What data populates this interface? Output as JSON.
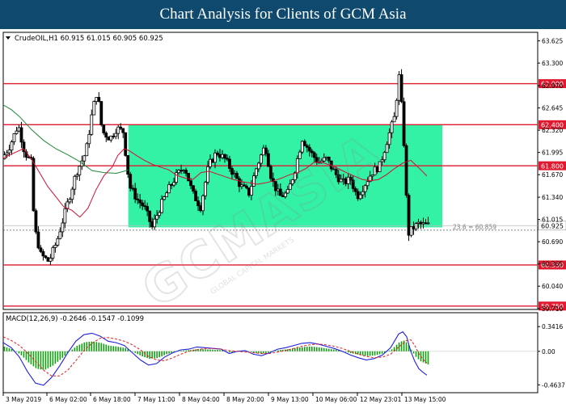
{
  "header": {
    "title": "Chart Analysis for Clients of GCM Asia"
  },
  "watermark": {
    "text": "GCMASIA",
    "sub": "GLOBAL CAPITAL MARKETS"
  },
  "chart_data": {
    "type": "candlestick",
    "symbol_info": "CrudeOIL,H1  60.915 61.015 60.905 60.925",
    "y_ticks": [
      "63.625",
      "63.300",
      "62.970",
      "62.645",
      "62.320",
      "61.995",
      "61.670",
      "61.340",
      "61.015",
      "60.690",
      "60.365",
      "60.040",
      "59.710"
    ],
    "ylim": [
      59.7,
      63.75
    ],
    "x_labels": [
      "3 May 2019",
      "6 May 02:00",
      "6 May 18:00",
      "7 May 11:00",
      "8 May 04:00",
      "8 May 20:00",
      "9 May 13:00",
      "10 May 06:00",
      "12 May 23:01",
      "13 May 15:00"
    ],
    "levels": [
      {
        "value": "63.000",
        "color": "#e0192f"
      },
      {
        "value": "62.400",
        "color": "#e0192f"
      },
      {
        "value": "61.800",
        "color": "#e0192f"
      },
      {
        "value": "60.350",
        "color": "#e0192f"
      },
      {
        "value": "59.750",
        "color": "#e0192f"
      }
    ],
    "zone": {
      "from": 60.9,
      "to": 62.4,
      "color": "#33f2a6"
    },
    "fib": {
      "label": "23.6 = 60.859",
      "value": 60.859
    },
    "bid": {
      "label": "60.925",
      "value": 60.925
    },
    "ma_series": [
      {
        "name": "",
        "color": "#1f8a3a",
        "points": [
          [
            0,
            62.69
          ],
          [
            10,
            62.62
          ],
          [
            20,
            62.52
          ],
          [
            35,
            62.33
          ],
          [
            50,
            62.17
          ],
          [
            65,
            62.05
          ],
          [
            80,
            61.96
          ],
          [
            95,
            61.86
          ],
          [
            110,
            61.73
          ],
          [
            125,
            61.7
          ],
          [
            140,
            61.69
          ],
          [
            150,
            61.72
          ],
          [
            155,
            61.74
          ]
        ]
      },
      {
        "name": "",
        "color": "#d01030",
        "points": [
          [
            0,
            61.91
          ],
          [
            12,
            61.98
          ],
          [
            25,
            62.05
          ],
          [
            35,
            61.9
          ],
          [
            45,
            61.7
          ],
          [
            55,
            61.5
          ],
          [
            65,
            61.35
          ],
          [
            75,
            61.2
          ],
          [
            85,
            61.15
          ],
          [
            95,
            61.05
          ],
          [
            105,
            61.18
          ],
          [
            115,
            61.45
          ],
          [
            125,
            61.66
          ],
          [
            135,
            61.78
          ],
          [
            142,
            61.95
          ],
          [
            150,
            62.05
          ],
          [
            156,
            62.02
          ],
          [
            165,
            61.95
          ],
          [
            175,
            61.88
          ],
          [
            185,
            61.82
          ],
          [
            195,
            61.78
          ],
          [
            205,
            61.74
          ],
          [
            215,
            61.66
          ],
          [
            225,
            61.62
          ],
          [
            235,
            61.6
          ],
          [
            245,
            61.7
          ],
          [
            255,
            61.72
          ],
          [
            265,
            61.68
          ],
          [
            275,
            61.64
          ],
          [
            285,
            61.6
          ],
          [
            295,
            61.57
          ],
          [
            305,
            61.55
          ],
          [
            315,
            61.53
          ],
          [
            325,
            61.55
          ],
          [
            335,
            61.58
          ],
          [
            345,
            61.62
          ],
          [
            355,
            61.67
          ],
          [
            365,
            61.7
          ],
          [
            375,
            61.76
          ],
          [
            385,
            61.85
          ],
          [
            395,
            61.85
          ],
          [
            405,
            61.81
          ],
          [
            415,
            61.76
          ],
          [
            425,
            61.7
          ],
          [
            435,
            61.65
          ],
          [
            445,
            61.6
          ],
          [
            455,
            61.58
          ],
          [
            465,
            61.6
          ],
          [
            475,
            61.67
          ],
          [
            485,
            61.76
          ],
          [
            495,
            61.84
          ],
          [
            505,
            61.88
          ],
          [
            515,
            61.77
          ],
          [
            525,
            61.65
          ]
        ]
      }
    ],
    "macd": {
      "label": "MACD(12,26,9) -0.2646 -0.1547 -0.1099",
      "y_ticks": [
        "0.3416",
        "0.00",
        "-0.4637"
      ],
      "ylim": [
        -0.55,
        0.4
      ],
      "macd_color": "#2020e0",
      "signal_color": "#e02020",
      "hist_color": "#12a012",
      "macd_line": [
        [
          0,
          0.12
        ],
        [
          10,
          0.05
        ],
        [
          20,
          -0.08
        ],
        [
          30,
          -0.28
        ],
        [
          40,
          -0.44
        ],
        [
          50,
          -0.47
        ],
        [
          60,
          -0.36
        ],
        [
          70,
          -0.2
        ],
        [
          80,
          -0.02
        ],
        [
          90,
          0.14
        ],
        [
          100,
          0.23
        ],
        [
          110,
          0.25
        ],
        [
          120,
          0.21
        ],
        [
          130,
          0.14
        ],
        [
          140,
          0.12
        ],
        [
          150,
          0.08
        ],
        [
          160,
          -0.02
        ],
        [
          170,
          -0.12
        ],
        [
          180,
          -0.19
        ],
        [
          190,
          -0.17
        ],
        [
          200,
          -0.08
        ],
        [
          210,
          -0.02
        ],
        [
          220,
          0.02
        ],
        [
          230,
          0.03
        ],
        [
          240,
          0.06
        ],
        [
          250,
          0.05
        ],
        [
          260,
          0.04
        ],
        [
          270,
          0.03
        ],
        [
          280,
          -0.03
        ],
        [
          290,
          0.0
        ],
        [
          300,
          0.01
        ],
        [
          310,
          -0.04
        ],
        [
          320,
          -0.06
        ],
        [
          330,
          -0.02
        ],
        [
          340,
          0.03
        ],
        [
          350,
          0.05
        ],
        [
          360,
          0.08
        ],
        [
          370,
          0.11
        ],
        [
          380,
          0.12
        ],
        [
          390,
          0.1
        ],
        [
          400,
          0.07
        ],
        [
          410,
          0.04
        ],
        [
          420,
          0.0
        ],
        [
          430,
          -0.05
        ],
        [
          440,
          -0.09
        ],
        [
          450,
          -0.12
        ],
        [
          460,
          -0.1
        ],
        [
          470,
          -0.05
        ],
        [
          480,
          0.05
        ],
        [
          490,
          0.24
        ],
        [
          495,
          0.27
        ],
        [
          500,
          0.2
        ],
        [
          505,
          0.0
        ],
        [
          510,
          -0.14
        ],
        [
          515,
          -0.24
        ],
        [
          520,
          -0.29
        ],
        [
          525,
          -0.33
        ]
      ],
      "signal_line": [
        [
          0,
          0.2
        ],
        [
          10,
          0.15
        ],
        [
          20,
          0.08
        ],
        [
          30,
          -0.02
        ],
        [
          40,
          -0.14
        ],
        [
          50,
          -0.26
        ],
        [
          60,
          -0.34
        ],
        [
          70,
          -0.34
        ],
        [
          80,
          -0.26
        ],
        [
          90,
          -0.13
        ],
        [
          100,
          0.01
        ],
        [
          110,
          0.11
        ],
        [
          120,
          0.18
        ],
        [
          130,
          0.19
        ],
        [
          140,
          0.17
        ],
        [
          150,
          0.14
        ],
        [
          160,
          0.09
        ],
        [
          170,
          0.02
        ],
        [
          180,
          -0.07
        ],
        [
          190,
          -0.12
        ],
        [
          200,
          -0.13
        ],
        [
          210,
          -0.09
        ],
        [
          220,
          -0.04
        ],
        [
          230,
          0.0
        ],
        [
          240,
          0.02
        ],
        [
          250,
          0.04
        ],
        [
          260,
          0.04
        ],
        [
          270,
          0.03
        ],
        [
          280,
          0.01
        ],
        [
          290,
          0.0
        ],
        [
          300,
          -0.01
        ],
        [
          310,
          -0.02
        ],
        [
          320,
          -0.03
        ],
        [
          330,
          -0.03
        ],
        [
          340,
          -0.01
        ],
        [
          350,
          0.01
        ],
        [
          360,
          0.04
        ],
        [
          370,
          0.07
        ],
        [
          380,
          0.09
        ],
        [
          390,
          0.1
        ],
        [
          400,
          0.09
        ],
        [
          410,
          0.07
        ],
        [
          420,
          0.04
        ],
        [
          430,
          0.0
        ],
        [
          440,
          -0.04
        ],
        [
          450,
          -0.07
        ],
        [
          460,
          -0.09
        ],
        [
          470,
          -0.08
        ],
        [
          480,
          -0.04
        ],
        [
          490,
          0.06
        ],
        [
          500,
          0.15
        ],
        [
          505,
          0.16
        ],
        [
          510,
          0.08
        ],
        [
          515,
          -0.03
        ],
        [
          520,
          -0.11
        ],
        [
          525,
          -0.16
        ]
      ]
    }
  }
}
